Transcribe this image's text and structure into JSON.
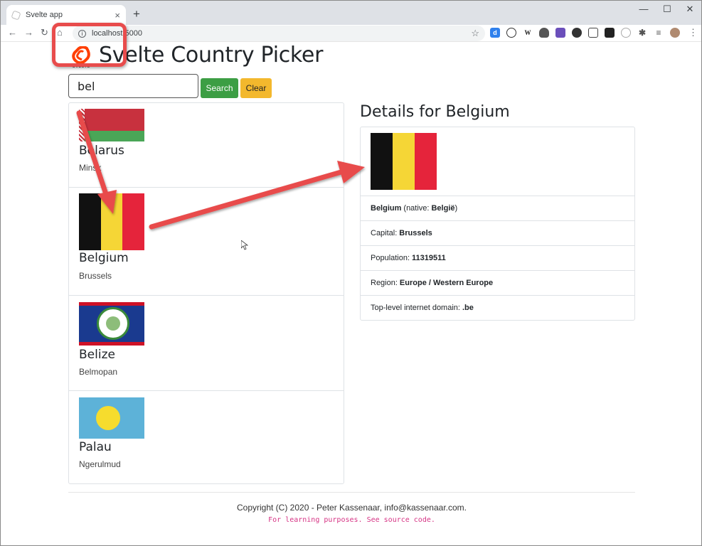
{
  "browser": {
    "tab_title": "Svelte app",
    "new_tab": "+",
    "close_tab": "×",
    "url": "localhost:5000",
    "window_controls": {
      "minimize": "—",
      "maximize": "☐",
      "close": "✕"
    }
  },
  "app": {
    "logo_text": "SVELTE",
    "title": "Svelte Country Picker",
    "search": {
      "value": "bel",
      "button": "Search",
      "clear": "Clear"
    }
  },
  "countries": [
    {
      "name": "Belarus",
      "capital": "Minsk",
      "flag": "belarus-flag"
    },
    {
      "name": "Belgium",
      "capital": "Brussels",
      "flag": "belgium-flag"
    },
    {
      "name": "Belize",
      "capital": "Belmopan",
      "flag": "belize-flag"
    },
    {
      "name": "Palau",
      "capital": "Ngerulmud",
      "flag": "palau-flag"
    }
  ],
  "details": {
    "title": "Details for Belgium",
    "name": "Belgium",
    "native_label": "(native:",
    "native": "België",
    "native_close": ")",
    "capital_label": "Capital:",
    "capital": "Brussels",
    "population_label": "Population:",
    "population": "11319511",
    "region_label": "Region:",
    "region": "Europe / Western Europe",
    "domain_label": "Top-level internet domain:",
    "domain": ".be"
  },
  "footer": {
    "copyright": "Copyright (C) 2020 - Peter Kassenaar, info@kassenaar.com.",
    "note": "For learning purposes. See source code."
  },
  "colors": {
    "annotation": "#e84c4c",
    "search_button": "#3c9e44",
    "clear_button": "#f3b82d",
    "svelte": "#ff3e00"
  }
}
